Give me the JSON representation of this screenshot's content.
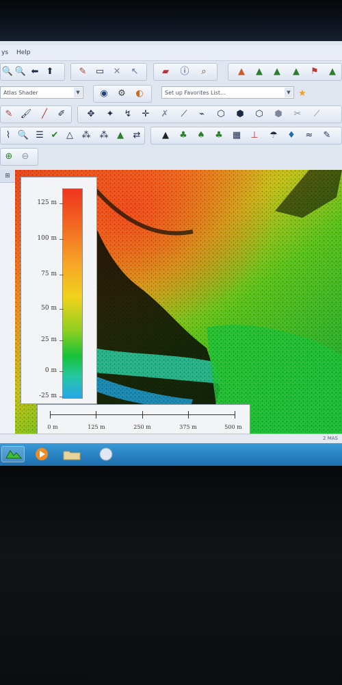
{
  "menu": {
    "items": [
      "ys",
      "Help"
    ]
  },
  "toolbar": {
    "shader_combo": "Atlas Shader",
    "favorites_combo": "Set up Favorites List..."
  },
  "left_panel": {
    "tab_label": "⊞"
  },
  "legend": {
    "labels": [
      "125 m",
      "100 m",
      "75 m",
      "50 m",
      "25 m",
      "0 m",
      "-25 m"
    ],
    "colors": {
      "high": "#f0331f",
      "mid": "#f0d21c",
      "low": "#27a6e8"
    }
  },
  "scale": {
    "labels": [
      "0 m",
      "125 m",
      "250 m",
      "375 m",
      "500 m"
    ]
  },
  "status": {
    "text": "2 MAS"
  },
  "taskbar": {
    "items": [
      "globalmapper-app",
      "media-player",
      "file-explorer",
      "browser"
    ]
  }
}
